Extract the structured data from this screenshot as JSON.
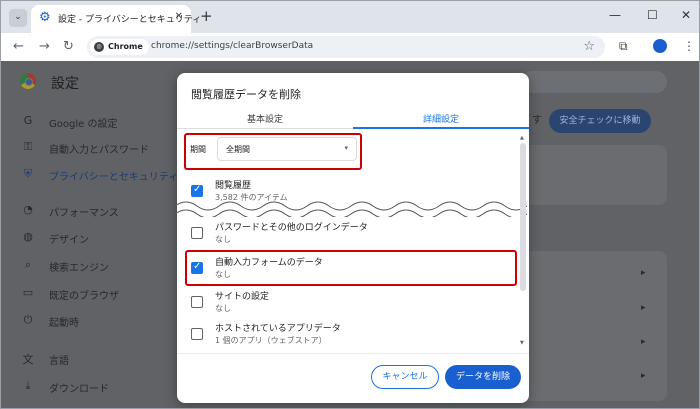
{
  "browser": {
    "tab_title": "設定 - プライバシーとセキュリティ",
    "new_tab": "+",
    "tab_close": "✕",
    "tab_menu": "⌄",
    "window_controls": {
      "minimize": "—",
      "maximize": "☐",
      "close": "✕"
    },
    "nav": {
      "back": "←",
      "forward": "→",
      "reload": "↻"
    },
    "chip_label": "Chrome",
    "url": "chrome://settings/clearBrowserData",
    "star": "☆",
    "menu_dots": "⋮"
  },
  "settings": {
    "title": "設定",
    "sub_heading": "す",
    "nav_items": [
      {
        "icon": "G",
        "label": "Google の設定"
      },
      {
        "icon": "⚿",
        "label": "自動入力とパスワード"
      },
      {
        "icon": "⛨",
        "label": "プライバシーとセキュリティ"
      },
      {
        "icon": "◔",
        "label": "パフォーマンス"
      },
      {
        "icon": "◍",
        "label": "デザイン"
      },
      {
        "icon": "⌕",
        "label": "検索エンジン"
      },
      {
        "icon": "▭",
        "label": "既定のブラウザ"
      },
      {
        "icon": "⏻",
        "label": "起動時"
      },
      {
        "icon": "文",
        "label": "言語"
      },
      {
        "icon": "⤓",
        "label": "ダウンロード"
      }
    ],
    "safety_check_button": "安全チェックに移動",
    "row_arrow": "▸"
  },
  "dialog": {
    "title": "閲覧履歴データを削除",
    "tabs": [
      {
        "label": "基本設定",
        "selected": false
      },
      {
        "label": "詳細設定",
        "selected": true
      }
    ],
    "period_label": "期間",
    "period_value": "全期間",
    "period_arrow": "▾",
    "options": [
      {
        "title": "閲覧履歴",
        "sub": "3,582 件のアイテム",
        "checked": true
      },
      {
        "title": "パスワードとその他のログインデータ",
        "sub": "なし",
        "checked": false
      },
      {
        "title": "自動入力フォームのデータ",
        "sub": "なし",
        "checked": true
      },
      {
        "title": "サイトの設定",
        "sub": "なし",
        "checked": false
      },
      {
        "title": "ホストされているアプリデータ",
        "sub": "1 個のアプリ（ウェブストア）",
        "checked": false
      }
    ],
    "cancel_label": "キャンセル",
    "delete_label": "データを削除"
  },
  "colors": {
    "accent": "#1a73e8",
    "highlight_border": "#cc0000",
    "overlay": "#606266"
  }
}
